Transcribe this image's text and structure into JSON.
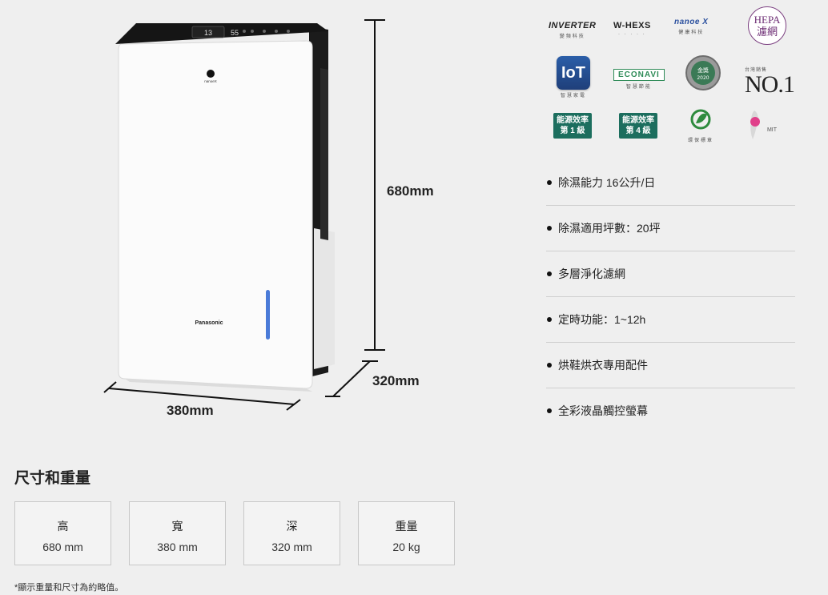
{
  "product": {
    "logo_text": "nanoeX",
    "brand": "Panasonic",
    "display_digits": "13",
    "display_digits_2": "55"
  },
  "dimensions": {
    "height_label": "680mm",
    "width_label": "380mm",
    "depth_label": "320mm"
  },
  "badges": {
    "inverter": {
      "title": "INVERTER",
      "sub": "變頻科技"
    },
    "whexs": {
      "title": "W-HEXS",
      "sub": ""
    },
    "nanoe": {
      "title": "nanoe X",
      "sub": "健康科技"
    },
    "hepa": {
      "line1": "HEPA",
      "line2": "濾網"
    },
    "iot": {
      "title": "IoT",
      "sub": "智慧家電"
    },
    "econavi": {
      "title": "ECONAVI",
      "sub": "智慧節能"
    },
    "award": {
      "title": "金獎",
      "sub": "2020"
    },
    "no1": {
      "top": "台灣銷售",
      "title": "NO.1"
    },
    "energy1": {
      "line1": "能源效率",
      "line2": "第 1 級"
    },
    "energy4": {
      "line1": "能源效率",
      "line2": "第 4 級"
    },
    "green": {
      "sub": "環保標章"
    },
    "mit": {
      "sub": "MIT"
    }
  },
  "features": [
    "除濕能力 16公升/日",
    "除濕適用坪數：20坪",
    "多層淨化濾網",
    "定時功能：1~12h",
    "烘鞋烘衣專用配件",
    "全彩液晶觸控螢幕"
  ],
  "specs": {
    "title": "尺寸和重量",
    "items": [
      {
        "label": "高",
        "value": "680 mm"
      },
      {
        "label": "寬",
        "value": "380 mm"
      },
      {
        "label": "深",
        "value": "320 mm"
      },
      {
        "label": "重量",
        "value": "20 kg"
      }
    ],
    "footnote": "*顯示重量和尺寸為約略值。"
  },
  "colors": {
    "background": "#efefef",
    "accent_blue": "#4a7bd8",
    "energy_green": "#1c6e5e"
  }
}
